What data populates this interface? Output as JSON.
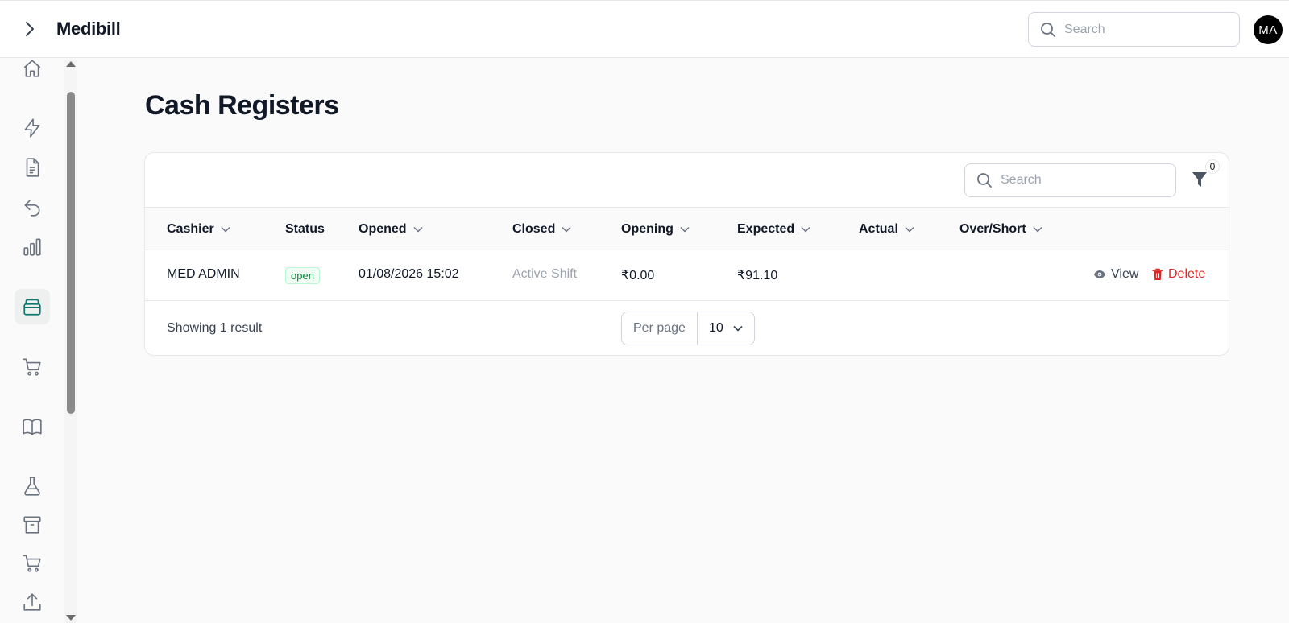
{
  "header": {
    "brand": "Medibill",
    "search_placeholder": "Search",
    "avatar_initials": "MA"
  },
  "sidebar": {
    "items": [
      {
        "icon": "home-icon"
      },
      {
        "icon": "lightning-icon"
      },
      {
        "icon": "document-icon"
      },
      {
        "icon": "return-icon"
      },
      {
        "icon": "bar-chart-icon"
      },
      {
        "icon": "cash-register-icon",
        "active": true
      },
      {
        "icon": "cart-icon"
      },
      {
        "icon": "book-icon"
      },
      {
        "icon": "flask-icon"
      },
      {
        "icon": "archive-icon"
      },
      {
        "icon": "cart-icon"
      },
      {
        "icon": "upload-icon"
      }
    ]
  },
  "page": {
    "title": "Cash Registers"
  },
  "table": {
    "search_placeholder": "Search",
    "filter_count": "0",
    "columns": [
      "Cashier",
      "Status",
      "Opened",
      "Closed",
      "Opening",
      "Expected",
      "Actual",
      "Over/Short"
    ],
    "rows": [
      {
        "cashier": "MED ADMIN",
        "status": "open",
        "opened": "01/08/2026 15:02",
        "closed": "Active Shift",
        "opening": "₹0.00",
        "expected": "₹91.10",
        "actual": "",
        "over_short": "",
        "view_label": "View",
        "delete_label": "Delete"
      }
    ],
    "footer": {
      "showing": "Showing 1 result",
      "per_page_label": "Per page",
      "per_page_value": "10"
    }
  },
  "colors": {
    "accent": "#0f766e",
    "danger": "#dc2626",
    "status_open": "#15803d"
  }
}
